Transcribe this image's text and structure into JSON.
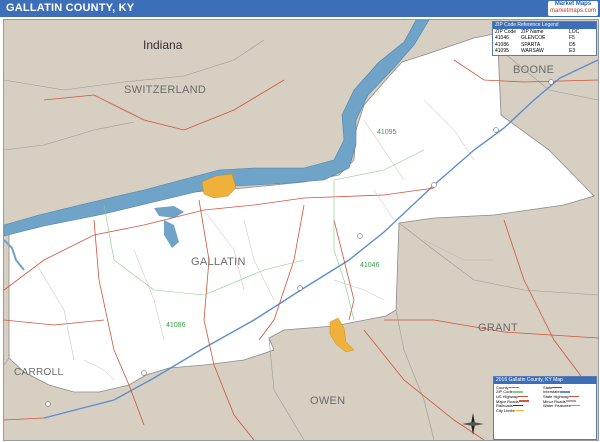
{
  "title": "GALLATIN COUNTY, KY",
  "logo": {
    "line1": "Market Maps",
    "line2": "marketmaps.com"
  },
  "labels": {
    "indiana": "Indiana",
    "switzerland": "SWITZERLAND",
    "boone": "BOONE",
    "gallatin": "GALLATIN",
    "grant": "GRANT",
    "carroll": "CARROLL",
    "owen": "OWEN"
  },
  "zips_on_map": [
    "41095",
    "41046",
    "41086"
  ],
  "legend": {
    "title": "ZIP Code Reference Legend",
    "headers": [
      "ZIP Code",
      "ZIP Name",
      "LOC"
    ],
    "rows": [
      [
        "41046",
        "GLENCOE",
        "F5"
      ],
      [
        "41086",
        "SPARTA",
        "D5"
      ],
      [
        "41095",
        "WARSAW",
        "E3"
      ]
    ]
  },
  "key": {
    "title": "2016 Gallatin County, KY Map",
    "items": [
      "County",
      "State",
      "ZIP Code",
      "Interstate",
      "US Highway",
      "State Highway",
      "Major Roads",
      "Minor Roads",
      "Railroads",
      "Water Features",
      "City Limits"
    ]
  },
  "colors": {
    "header": "#3d6fb8",
    "water": "#6fa3c7",
    "outside": "#d6cfc2",
    "city": "#f0b13a",
    "zip_label": "#3aa14a",
    "interstate": "#5b8fd0",
    "road": "#d1553a"
  }
}
